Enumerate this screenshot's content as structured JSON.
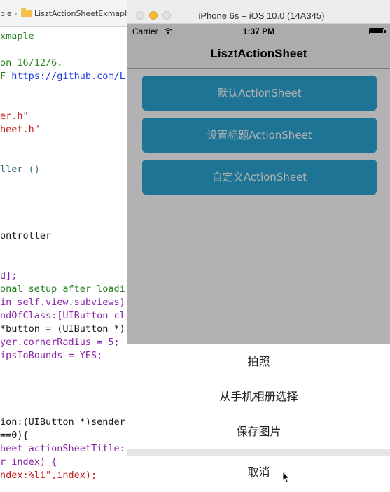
{
  "xcode": {
    "breadcrumb": [
      "ple",
      "LisztActionSheetExmaple"
    ],
    "code_lines": [
      {
        "text": "xmaple",
        "color": "green"
      },
      {
        "text": "",
        "color": "black"
      },
      {
        "text": "on 16/12/6.",
        "color": "green"
      },
      {
        "text": "F ",
        "color": "green",
        "link": "https://github.com/L"
      },
      {
        "text": "",
        "color": "black"
      },
      {
        "text": "",
        "color": "black"
      },
      {
        "text": "er.h\"",
        "color": "red"
      },
      {
        "text": "heet.h\"",
        "color": "red"
      },
      {
        "text": "",
        "color": "black"
      },
      {
        "text": "",
        "color": "black"
      },
      {
        "text": "ller ()",
        "color": "teal"
      },
      {
        "text": "",
        "color": "black"
      },
      {
        "text": "",
        "color": "black"
      },
      {
        "text": "",
        "color": "black"
      },
      {
        "text": "",
        "color": "black"
      },
      {
        "text": "ontroller",
        "color": "black"
      },
      {
        "text": "",
        "color": "black"
      },
      {
        "text": "",
        "color": "black"
      },
      {
        "text": "d];",
        "color": "purple"
      },
      {
        "text": "onal setup after loadir",
        "color": "green"
      },
      {
        "text": "in self.view.subviews)",
        "color": "purple"
      },
      {
        "text": "ndOfClass:[UIButton cl",
        "color": "purple"
      },
      {
        "text": "*button = (UIButton *)",
        "color": "black"
      },
      {
        "text": "yer.cornerRadius = 5;",
        "color": "purple"
      },
      {
        "text": "ipsToBounds = YES;",
        "color": "purple"
      },
      {
        "text": "",
        "color": "black"
      },
      {
        "text": "",
        "color": "black"
      },
      {
        "text": "",
        "color": "black"
      },
      {
        "text": "",
        "color": "black"
      },
      {
        "text": "ion:(UIButton *)sender",
        "color": "black"
      },
      {
        "text": "==0){",
        "color": "black"
      },
      {
        "text": "heet actionSheetTitle:",
        "color": "purple"
      },
      {
        "text": "r index) {",
        "color": "purple"
      },
      {
        "text": "ndex:%li\",index);",
        "color": "red"
      }
    ]
  },
  "simulator": {
    "window_title": "iPhone 6s – iOS 10.0 (14A345)",
    "status_bar": {
      "carrier": "Carrier",
      "time": "1:37 PM",
      "icons": [
        "wifi-icon",
        "battery-icon"
      ]
    },
    "nav_title": "LisztActionSheet",
    "buttons": [
      {
        "label": "默认ActionSheet"
      },
      {
        "label": "设置标题ActionSheet"
      },
      {
        "label": "自定义ActionSheet"
      }
    ],
    "action_sheet": {
      "items": [
        "拍照",
        "从手机相册选择",
        "保存图片"
      ],
      "cancel": "取消"
    },
    "colors": {
      "accent": "#2ca6d6",
      "dim_overlay": "rgba(0,0,0,0.3)",
      "sheet_separator": "#e6e6e6"
    }
  }
}
